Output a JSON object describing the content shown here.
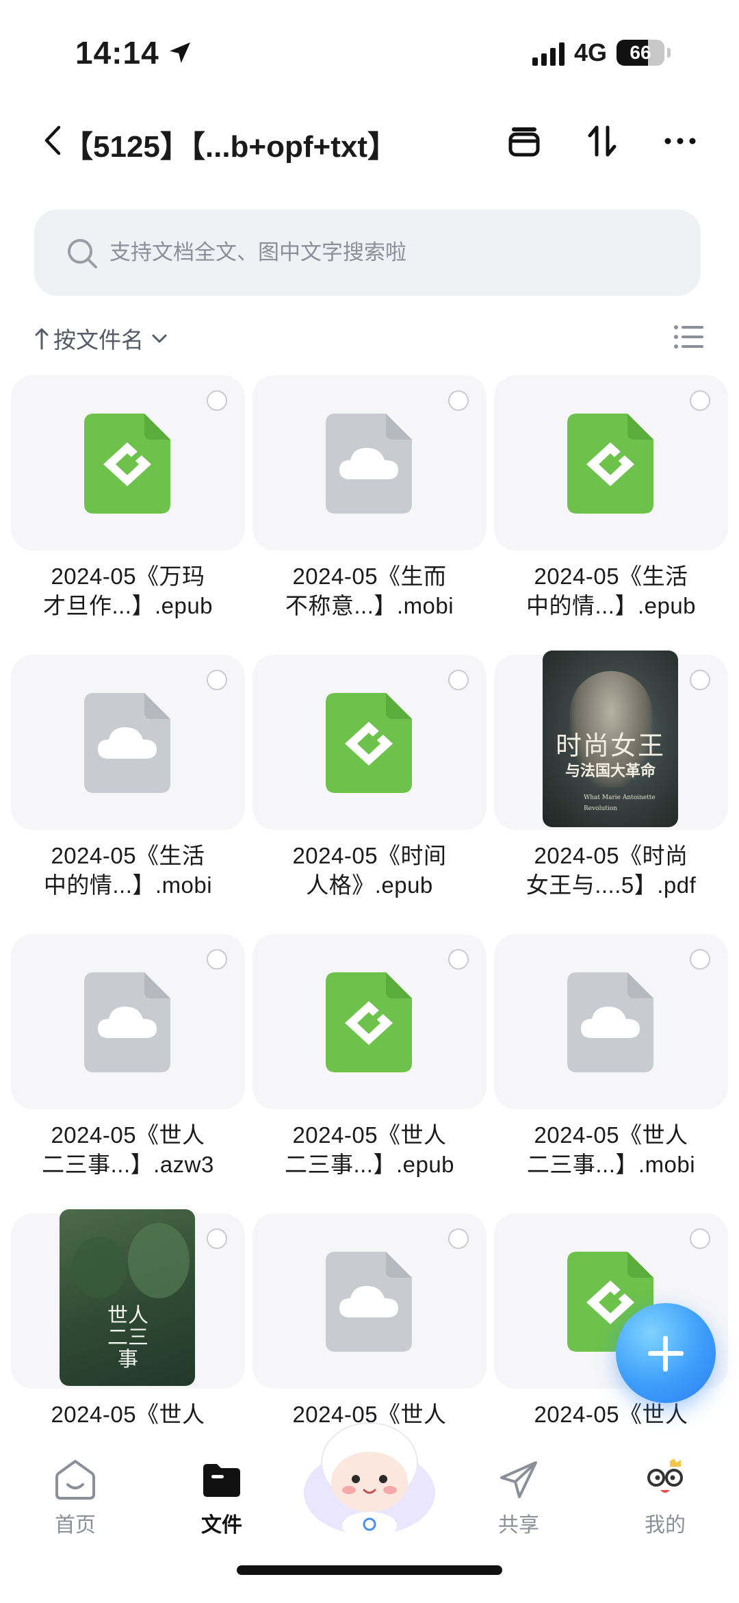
{
  "status_bar": {
    "time": "14:14",
    "network": "4G",
    "battery": "66",
    "battery_level": 0.66
  },
  "header": {
    "title": "【5125】【...b+opf+txt】"
  },
  "search": {
    "placeholder": "支持文档全文、图中文字搜索啦"
  },
  "sort": {
    "label": "按文件名"
  },
  "files": [
    {
      "name_line1": "2024-05《万玛",
      "name_line2": "才旦作...】.epub",
      "icon": "epub-icon"
    },
    {
      "name_line1": "2024-05《生而",
      "name_line2": "不称意...】.mobi",
      "icon": "cloud-file-icon"
    },
    {
      "name_line1": "2024-05《生活",
      "name_line2": "中的情...】.epub",
      "icon": "epub-icon"
    },
    {
      "name_line1": "2024-05《生活",
      "name_line2": "中的情...】.mobi",
      "icon": "cloud-file-icon"
    },
    {
      "name_line1": "2024-05《时间",
      "name_line2": "人格》.epub",
      "icon": "epub-icon"
    },
    {
      "name_line1": "2024-05《时尚",
      "name_line2": "女王与....5】.pdf",
      "icon": "book-cover-queen",
      "cover": {
        "title": "时尚女王",
        "subtitle": "与法国大革命",
        "caption_en": "What Marie Antoinette",
        "caption_en2": "Revolution"
      }
    },
    {
      "name_line1": "2024-05《世人",
      "name_line2": "二三事...】.azw3",
      "icon": "cloud-file-icon"
    },
    {
      "name_line1": "2024-05《世人",
      "name_line2": "二三事...】.epub",
      "icon": "epub-icon"
    },
    {
      "name_line1": "2024-05《世人",
      "name_line2": "二三事...】.mobi",
      "icon": "cloud-file-icon"
    },
    {
      "name_line1": "2024-05《世人",
      "name_line2": "",
      "icon": "book-cover-shiren",
      "cover": {
        "title": "世人二三事"
      }
    },
    {
      "name_line1": "2024-05《世人",
      "name_line2": "",
      "icon": "cloud-file-icon"
    },
    {
      "name_line1": "2024-05《世人",
      "name_line2": "",
      "icon": "epub-icon"
    }
  ],
  "tabbar": {
    "home": "首页",
    "files": "文件",
    "share": "共享",
    "mine": "我的"
  },
  "colors": {
    "epub_green": "#6cc24a",
    "cloud_gray": "#c9cbd1",
    "accent_blue": "#3c9dfa"
  }
}
